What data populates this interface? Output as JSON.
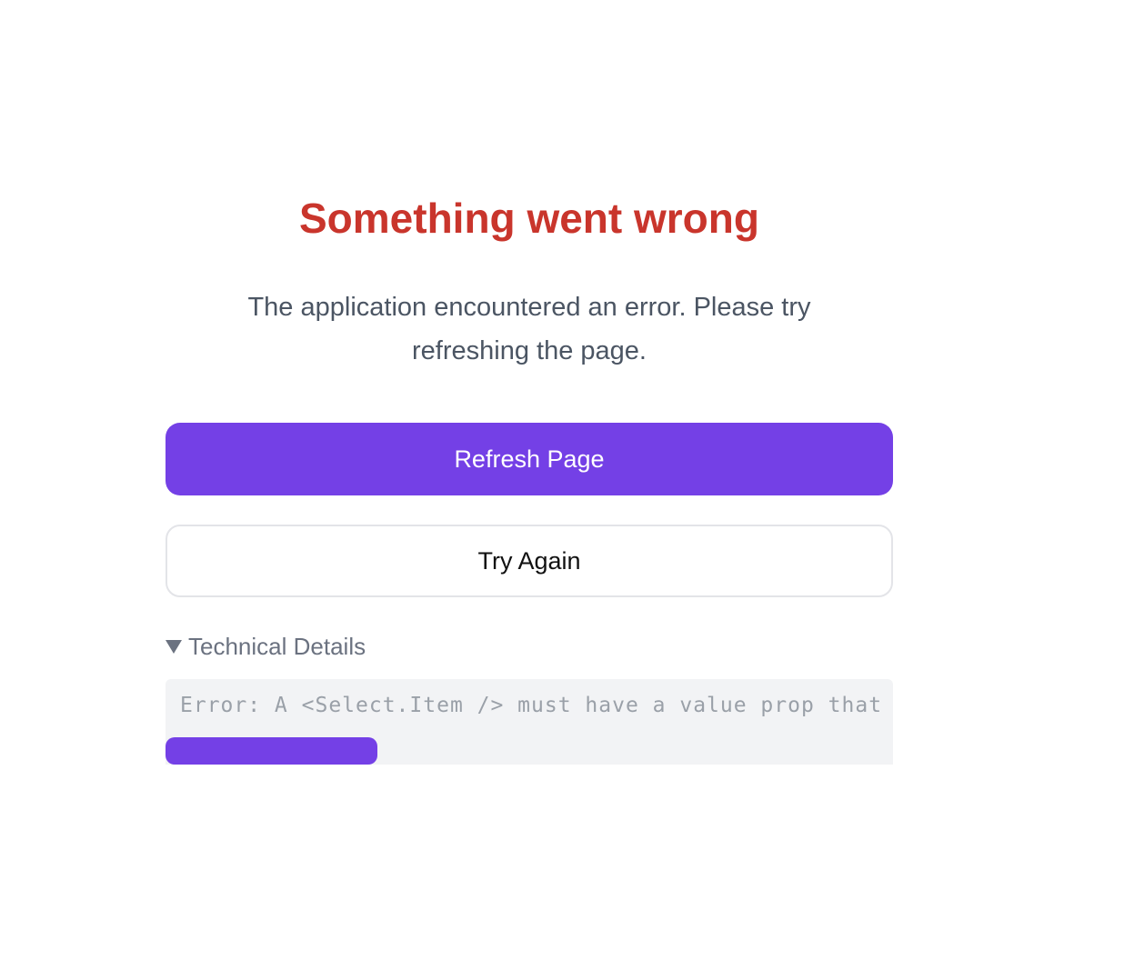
{
  "error_page": {
    "title": "Something went wrong",
    "message": "The application encountered an error. Please try refreshing the page.",
    "refresh_button_label": "Refresh Page",
    "try_again_button_label": "Try Again",
    "details": {
      "summary_label": "Technical Details",
      "expanded": true,
      "error_text": "Error: A <Select.Item /> must have a value prop that is"
    }
  },
  "colors": {
    "title": "#c9352c",
    "accent": "#7440e6",
    "muted_text": "#6b7280"
  },
  "icons": {
    "details_toggle": "triangle-down-icon"
  }
}
